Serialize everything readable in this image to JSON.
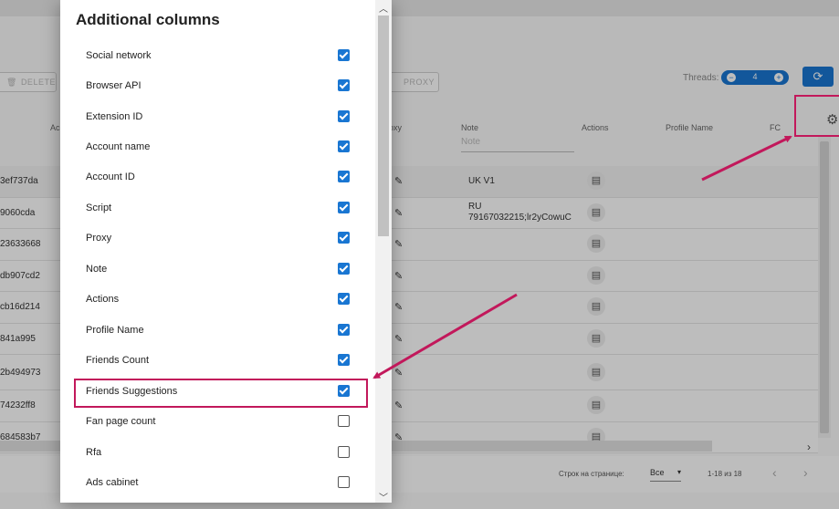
{
  "background_table": {
    "toolbar": {
      "delete_label": "DELETE",
      "proxy_label": "PROXY"
    },
    "threads": {
      "label": "Threads:",
      "value": "4"
    },
    "columns": [
      "Ac",
      "oxy",
      "Note",
      "Actions",
      "Profile Name",
      "FC"
    ],
    "note_placeholder": "Note",
    "rows": [
      {
        "id": "3ef737da",
        "note": "UK V1"
      },
      {
        "id": "9060cda",
        "note": "RU\n79167032215;lr2yCowuC"
      },
      {
        "id": "23633668",
        "note": ""
      },
      {
        "id": "db907cd2",
        "note": ""
      },
      {
        "id": "cb16d214",
        "note": ""
      },
      {
        "id": "841a995",
        "note": ""
      },
      {
        "id": "2b494973",
        "note": ""
      },
      {
        "id": "74232ff8",
        "note": ""
      },
      {
        "id": "684583b7",
        "note": ""
      }
    ],
    "footer": {
      "rows_per_page_label": "Строк на странице:",
      "rows_per_page_value": "Все",
      "range": "1-18 из 18"
    }
  },
  "dialog": {
    "title": "Additional columns",
    "items": [
      {
        "label": "Social network",
        "checked": true
      },
      {
        "label": "Browser API",
        "checked": true
      },
      {
        "label": "Extension ID",
        "checked": true
      },
      {
        "label": "Account name",
        "checked": true
      },
      {
        "label": "Account ID",
        "checked": true
      },
      {
        "label": "Script",
        "checked": true
      },
      {
        "label": "Proxy",
        "checked": true
      },
      {
        "label": "Note",
        "checked": true
      },
      {
        "label": "Actions",
        "checked": true
      },
      {
        "label": "Profile Name",
        "checked": true
      },
      {
        "label": "Friends Count",
        "checked": true
      },
      {
        "label": "Friends Suggestions",
        "checked": true
      },
      {
        "label": "Fan page count",
        "checked": false
      },
      {
        "label": "Rfa",
        "checked": false
      },
      {
        "label": "Ads cabinet",
        "checked": false
      }
    ]
  },
  "accent_color": "#1976d2",
  "annotation_color": "#c2185b"
}
